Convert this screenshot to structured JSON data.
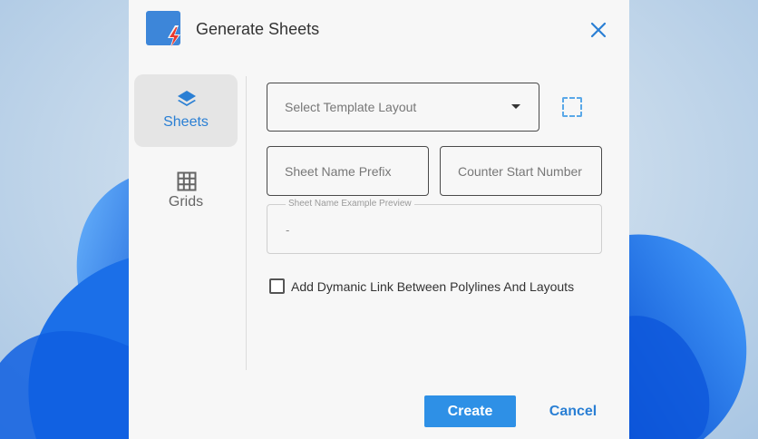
{
  "dialog": {
    "title": "Generate Sheets",
    "icons": {
      "app": "app-sheet-lightning-icon",
      "close": "close-icon"
    }
  },
  "nav": {
    "items": [
      {
        "label": "Sheets",
        "icon": "layers-icon",
        "active": true
      },
      {
        "label": "Grids",
        "icon": "grid-icon",
        "active": false
      }
    ]
  },
  "form": {
    "template_layout_placeholder": "Select Template Layout",
    "select_area_icon": "dashed-selection-icon",
    "sheet_name_prefix_placeholder": "Sheet Name Prefix",
    "counter_start_placeholder": "Counter Start Number",
    "preview_label": "Sheet Name Example Preview",
    "preview_value": "-",
    "dynamic_link_label": "Add Dymanic Link Between Polylines And Layouts",
    "dynamic_link_checked": false
  },
  "actions": {
    "create_label": "Create",
    "cancel_label": "Cancel"
  },
  "colors": {
    "accent": "#2e90e6",
    "accent_text": "#2a7fd4",
    "dialog_bg": "#f7f7f7"
  }
}
